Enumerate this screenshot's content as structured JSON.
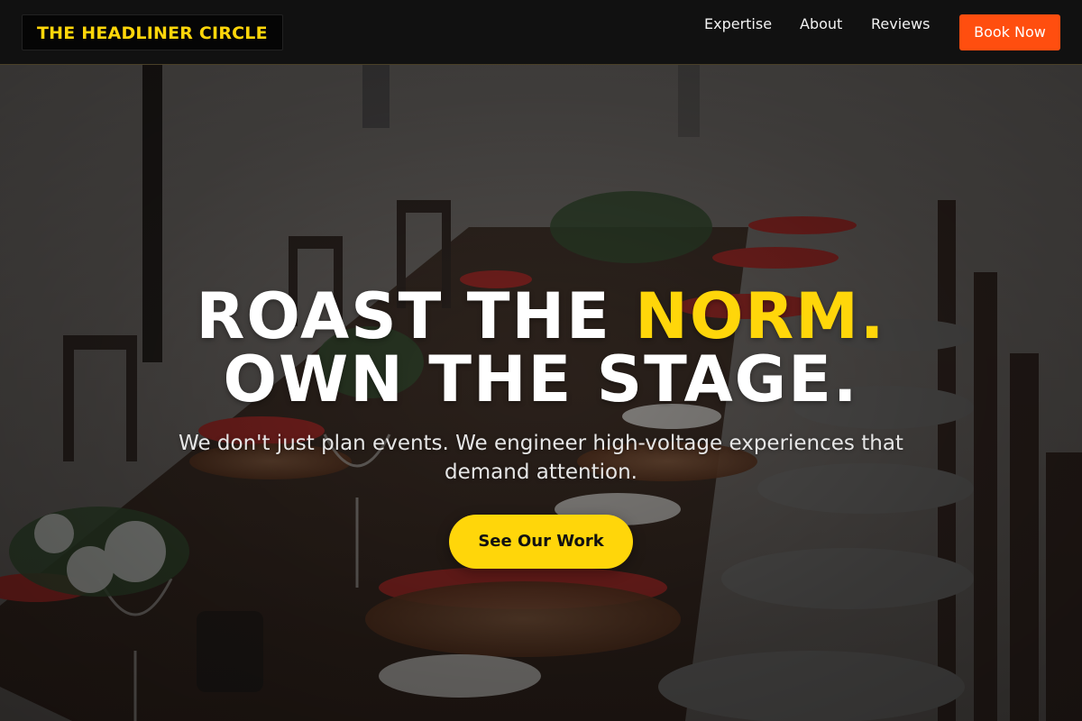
{
  "header": {
    "logo_text": "THE HEADLINER CIRCLE",
    "nav": [
      {
        "label": "Expertise"
      },
      {
        "label": "About"
      },
      {
        "label": "Reviews"
      }
    ],
    "cta_label": "Book Now"
  },
  "hero": {
    "headline_line1_main": "ROAST THE ",
    "headline_line1_accent": "NORM.",
    "headline_line2": "OWN THE STAGE.",
    "subtext": "We don't just plan events. We engineer high-voltage experiences that demand attention.",
    "cta_label": "See Our Work",
    "background_image": "outdoor-dining-table-icon"
  },
  "colors": {
    "accent_yellow": "#FFD60A",
    "accent_orange": "#FF4E0F",
    "header_bg": "#111111"
  }
}
